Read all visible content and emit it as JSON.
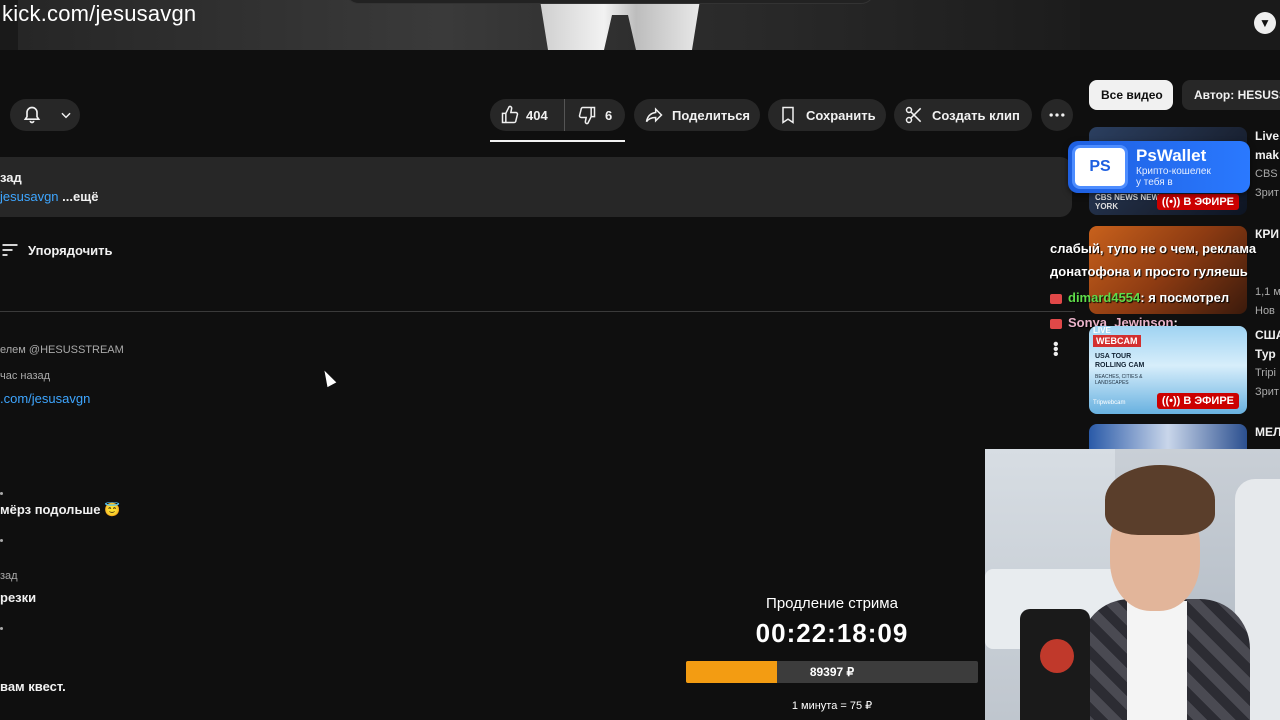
{
  "overlay": {
    "kick_url": "kick.com/jesusavgn"
  },
  "actions": {
    "likes": "404",
    "dislikes": "6",
    "share_label": "Поделиться",
    "save_label": "Сохранить",
    "clip_label": "Создать клип"
  },
  "description": {
    "line1": "зад",
    "link": "jesusavgn",
    "more": "...ещё"
  },
  "comments": {
    "sort_label": "Упорядочить",
    "pinned_by": "елем @HESUSSTREAM",
    "time1": "час назад",
    "link1": ".com/jesusavgn",
    "text2": "мёрз подольше 😇",
    "time3": "зад",
    "text3": "резки",
    "text4": "вам квест."
  },
  "sidebar": {
    "chips": [
      "Все видео",
      "Автор: HESUSSTREAM"
    ],
    "live_label": "В ЭФИРЕ",
    "videos": [
      {
        "title": "Live",
        "title2": "mak",
        "channel": "CBS",
        "views": "Зрит"
      },
      {
        "title": "КРИ",
        "title2": "",
        "channel": "1,1 м",
        "views": "Нов"
      },
      {
        "title": "США",
        "title2": "Тур",
        "channel": "Tripi",
        "views": "Зрит"
      },
      {
        "title": "МЕЛ",
        "title2": "",
        "channel": "",
        "views": ""
      }
    ],
    "thumb_texts": {
      "t1": "CBS NEWS NEW YORK",
      "t3": "USA TOUR ROLLING CAM",
      "t3_tag": "WEBCAM",
      "t3_live": "LIVE",
      "t3_sub": "BEACHES, CITIES & LANDSCAPES",
      "t3_logo": "Tripwebcam"
    }
  },
  "ad": {
    "name": "PsWallet",
    "logo": "PS",
    "sub1": "Крипто-кошелек",
    "sub2": "у тебя в"
  },
  "chat": [
    {
      "user": "",
      "text": "слабый, тупо не о чем, реклама"
    },
    {
      "user": "",
      "text": "донатофона и просто гуляешь"
    },
    {
      "user": "dimard4554",
      "text": ": я посмотрел"
    },
    {
      "user": "Sonya_Jewinson",
      "text": ":"
    }
  ],
  "extension": {
    "title": "Продление стрима",
    "timer": "00:22:18:09",
    "amount": "89397 ₽",
    "rate": "1 минута = 75 ₽",
    "progress": 0.31
  },
  "colors": {
    "accent_link": "#3ea6ff",
    "live_red": "#cc0000",
    "progress_orange": "#f39c12",
    "ad_blue": "#2a79ff"
  }
}
